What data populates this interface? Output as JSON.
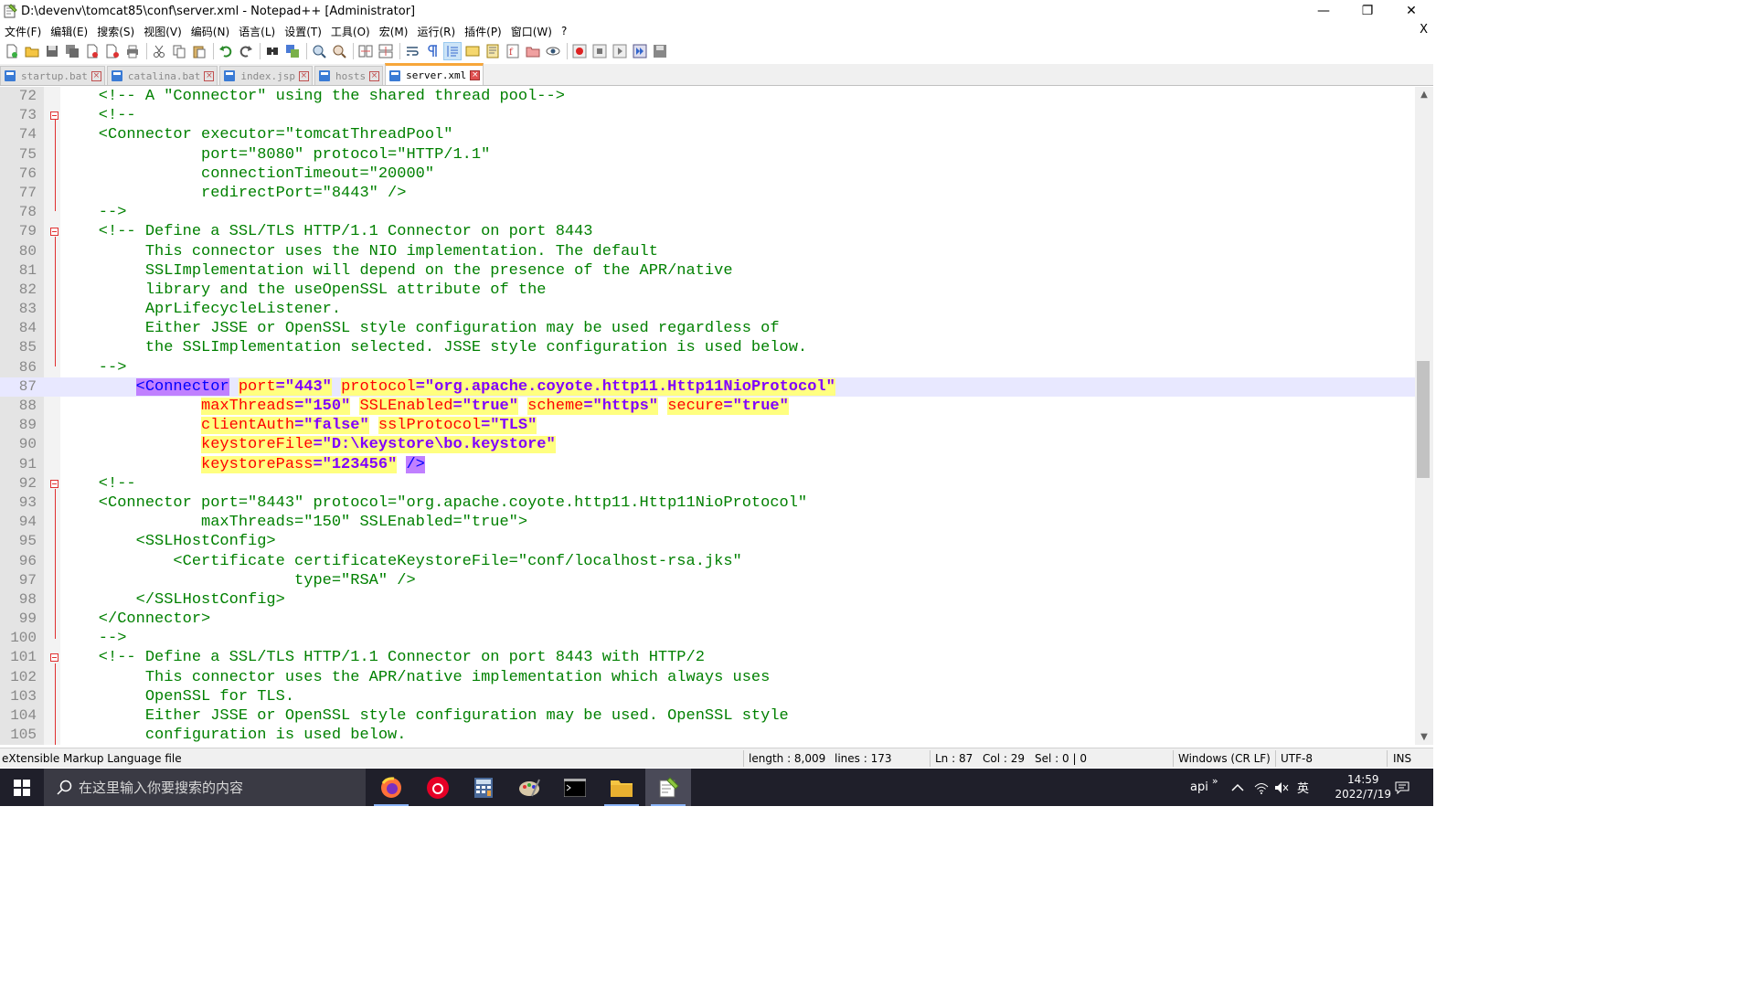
{
  "window": {
    "title": "D:\\devenv\\tomcat85\\conf\\server.xml - Notepad++ [Administrator]",
    "controls": {
      "minimize": "—",
      "maximize": "❐",
      "close": "✕"
    }
  },
  "menu": {
    "items": [
      "文件(F)",
      "编辑(E)",
      "搜索(S)",
      "视图(V)",
      "编码(N)",
      "语言(L)",
      "设置(T)",
      "工具(O)",
      "宏(M)",
      "运行(R)",
      "插件(P)",
      "窗口(W)",
      "?"
    ],
    "close": "X"
  },
  "tabs": [
    {
      "label": "startup.bat",
      "active": false
    },
    {
      "label": "catalina.bat",
      "active": false
    },
    {
      "label": "index.jsp",
      "active": false
    },
    {
      "label": "hosts",
      "active": false
    },
    {
      "label": "server.xml",
      "active": true
    }
  ],
  "editor": {
    "lines": [
      {
        "n": "72",
        "text": "    <!-- A \"Connector\" using the shared thread pool-->"
      },
      {
        "n": "73",
        "text": "    <!--"
      },
      {
        "n": "74",
        "text": "    <Connector executor=\"tomcatThreadPool\""
      },
      {
        "n": "75",
        "text": "               port=\"8080\" protocol=\"HTTP/1.1\""
      },
      {
        "n": "76",
        "text": "               connectionTimeout=\"20000\""
      },
      {
        "n": "77",
        "text": "               redirectPort=\"8443\" />"
      },
      {
        "n": "78",
        "text": "    -->"
      },
      {
        "n": "79",
        "text": "    <!-- Define a SSL/TLS HTTP/1.1 Connector on port 8443"
      },
      {
        "n": "80",
        "text": "         This connector uses the NIO implementation. The default"
      },
      {
        "n": "81",
        "text": "         SSLImplementation will depend on the presence of the APR/native"
      },
      {
        "n": "82",
        "text": "         library and the useOpenSSL attribute of the"
      },
      {
        "n": "83",
        "text": "         AprLifecycleListener."
      },
      {
        "n": "84",
        "text": "         Either JSSE or OpenSSL style configuration may be used regardless of"
      },
      {
        "n": "85",
        "text": "         the SSLImplementation selected. JSSE style configuration is used below."
      },
      {
        "n": "86",
        "text": "    -->"
      },
      {
        "n": "87",
        "pre": "        ",
        "tag": "<Connector",
        "sp1": " ",
        "a1": "port",
        "v1": "=\"443\"",
        "sp2": " ",
        "a2": "protocol",
        "v2": "=\"org.apache.coyote.http11.Http11NioProtocol\""
      },
      {
        "n": "88",
        "pre": "               ",
        "a1": "maxThreads",
        "v1": "=\"150\"",
        "a2": "SSLEnabled",
        "v2": "=\"true\"",
        "a3": "scheme",
        "v3": "=\"https\"",
        "a4": "secure",
        "v4": "=\"true\""
      },
      {
        "n": "89",
        "pre": "               ",
        "a1": "clientAuth",
        "v1": "=\"false\"",
        "a2": "sslProtocol",
        "v2": "=\"TLS\""
      },
      {
        "n": "90",
        "pre": "               ",
        "a1": "keystoreFile",
        "v1": "=\"D:\\keystore\\bo.keystore\""
      },
      {
        "n": "91",
        "pre": "               ",
        "a1": "keystorePass",
        "v1": "=\"123456\"",
        "close": "/>"
      },
      {
        "n": "92",
        "text": "    <!--"
      },
      {
        "n": "93",
        "text": "    <Connector port=\"8443\" protocol=\"org.apache.coyote.http11.Http11NioProtocol\""
      },
      {
        "n": "94",
        "text": "               maxThreads=\"150\" SSLEnabled=\"true\">"
      },
      {
        "n": "95",
        "text": "        <SSLHostConfig>"
      },
      {
        "n": "96",
        "text": "            <Certificate certificateKeystoreFile=\"conf/localhost-rsa.jks\""
      },
      {
        "n": "97",
        "text": "                         type=\"RSA\" />"
      },
      {
        "n": "98",
        "text": "        </SSLHostConfig>"
      },
      {
        "n": "99",
        "text": "    </Connector>"
      },
      {
        "n": "100",
        "text": "    -->"
      },
      {
        "n": "101",
        "text": "    <!-- Define a SSL/TLS HTTP/1.1 Connector on port 8443 with HTTP/2"
      },
      {
        "n": "102",
        "text": "         This connector uses the APR/native implementation which always uses"
      },
      {
        "n": "103",
        "text": "         OpenSSL for TLS."
      },
      {
        "n": "104",
        "text": "         Either JSSE or OpenSSL style configuration may be used. OpenSSL style"
      },
      {
        "n": "105",
        "text": "         configuration is used below."
      }
    ]
  },
  "status": {
    "filetype": "eXtensible Markup Language file",
    "length": "length : 8,009",
    "lines": "lines : 173",
    "ln": "Ln : 87",
    "col": "Col : 29",
    "sel": "Sel : 0 | 0",
    "eol": "Windows (CR LF)",
    "encoding": "UTF-8",
    "mode": "INS"
  },
  "taskbar": {
    "search_placeholder": "在这里输入你要搜索的内容",
    "tray_label": "api",
    "tray_overflow": "»",
    "ime": "英",
    "time": "14:59",
    "date": "2022/7/19"
  },
  "colors": {
    "comment": "#008000",
    "tag": "#0000ff",
    "attribute": "#ff0000",
    "value": "#8000ff",
    "highlight_yellow": "#ffff80",
    "highlight_purple": "#c080ff",
    "current_line": "#e8e8ff",
    "tab_accent": "#f7a63a"
  }
}
